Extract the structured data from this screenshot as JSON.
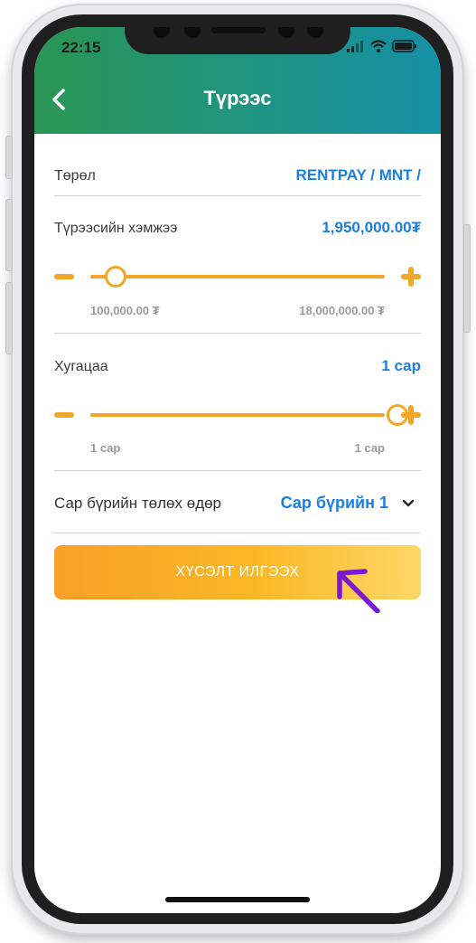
{
  "status": {
    "time": "22:15"
  },
  "header": {
    "title": "Түрээс"
  },
  "form": {
    "type": {
      "label": "Төрөл",
      "value": "RENTPAY / MNT /"
    },
    "amount": {
      "label": "Түрээсийн хэмжээ",
      "value": "1,950,000.00₮",
      "min": "100,000.00 ₮",
      "max": "18,000,000.00 ₮",
      "level": 0.06
    },
    "duration": {
      "label": "Хугацаа",
      "value": "1 сар",
      "min": "1 сар",
      "max": "1 сар",
      "level": 1.0
    },
    "payday": {
      "label": "Сар бүрийн төлөх өдөр",
      "value": "Сар бүрийн 1"
    },
    "submit": "ХҮСЭЛТ ИЛГЭЭХ"
  },
  "colors": {
    "accent": "#f4a629",
    "link": "#1a7fe0",
    "header_start": "#2a9553",
    "header_end": "#1590a6",
    "cursor": "#7b18d8"
  }
}
